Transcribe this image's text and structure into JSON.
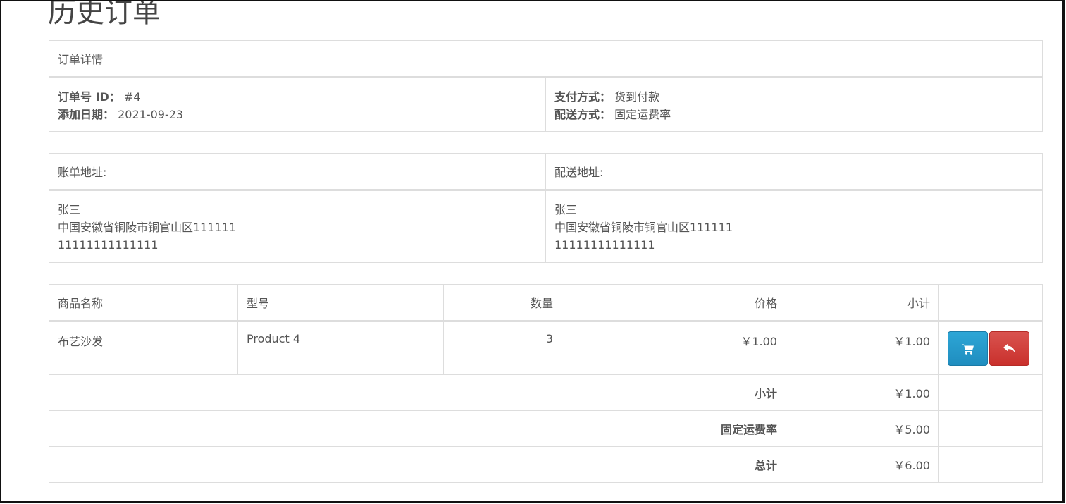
{
  "page": {
    "title": "历史订单"
  },
  "order_details": {
    "header": "订单详情",
    "order_id_label": "订单号 ID：",
    "order_id": "#4",
    "date_added_label": "添加日期：",
    "date_added": "2021-09-23",
    "payment_method_label": "支付方式：",
    "payment_method": "货到付款",
    "shipping_method_label": "配送方式：",
    "shipping_method": "固定运费率"
  },
  "addresses": {
    "payment_header": "账单地址:",
    "shipping_header": "配送地址:",
    "payment": {
      "name": "张三",
      "address": "中国安徽省铜陵市铜官山区111111",
      "phone": "11111111111111"
    },
    "shipping": {
      "name": "张三",
      "address": "中国安徽省铜陵市铜官山区111111",
      "phone": "11111111111111"
    }
  },
  "products": {
    "columns": [
      "商品名称",
      "型号",
      "数量",
      "价格",
      "小计"
    ],
    "rows": [
      {
        "name": "布艺沙发",
        "model": "Product 4",
        "quantity": "3",
        "price": "￥1.00",
        "total": "￥1.00"
      }
    ],
    "actions": {
      "reorder_icon": "shopping-cart-icon",
      "return_icon": "reply-icon"
    }
  },
  "totals": [
    {
      "label": "小计",
      "value": "￥1.00"
    },
    {
      "label": "固定运费率",
      "value": "￥5.00"
    },
    {
      "label": "总计",
      "value": "￥6.00"
    }
  ],
  "colors": {
    "reorder_button": "#2396c8",
    "return_button": "#d0413d",
    "border": "#dddddd"
  }
}
